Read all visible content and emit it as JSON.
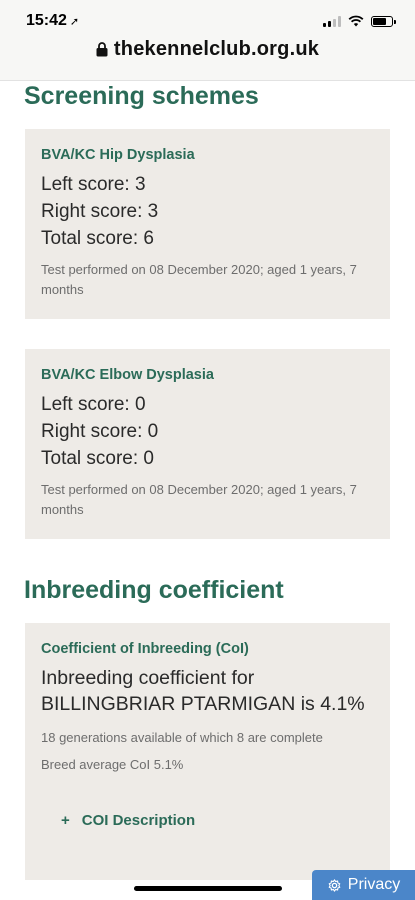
{
  "status": {
    "time": "15:42"
  },
  "browser": {
    "url": "thekennelclub.org.uk"
  },
  "screening": {
    "title": "Screening schemes",
    "hip": {
      "title": "BVA/KC Hip Dysplasia",
      "left": "Left score: 3",
      "right": "Right score: 3",
      "total": "Total score: 6",
      "meta": "Test performed on 08 December 2020; aged 1 years, 7 months"
    },
    "elbow": {
      "title": "BVA/KC Elbow Dysplasia",
      "left": "Left score: 0",
      "right": "Right score: 0",
      "total": "Total score: 0",
      "meta": "Test performed on 08 December 2020; aged 1 years, 7 months"
    }
  },
  "inbreeding": {
    "title": "Inbreeding coefficient",
    "card_title": "Coefficient of Inbreeding (CoI)",
    "summary": "Inbreeding coefficient for BILLINGBRIAR PTARMIGAN is 4.1%",
    "generations": "18 generations available of which 8 are complete",
    "breed_average": "Breed average CoI 5.1%",
    "description_label": "COI Description",
    "description_prefix": "+"
  },
  "privacy": {
    "label": "Privacy"
  },
  "colors": {
    "accent": "#2b6b58",
    "card": "#eeebe7",
    "privacy": "#4b86c9"
  }
}
